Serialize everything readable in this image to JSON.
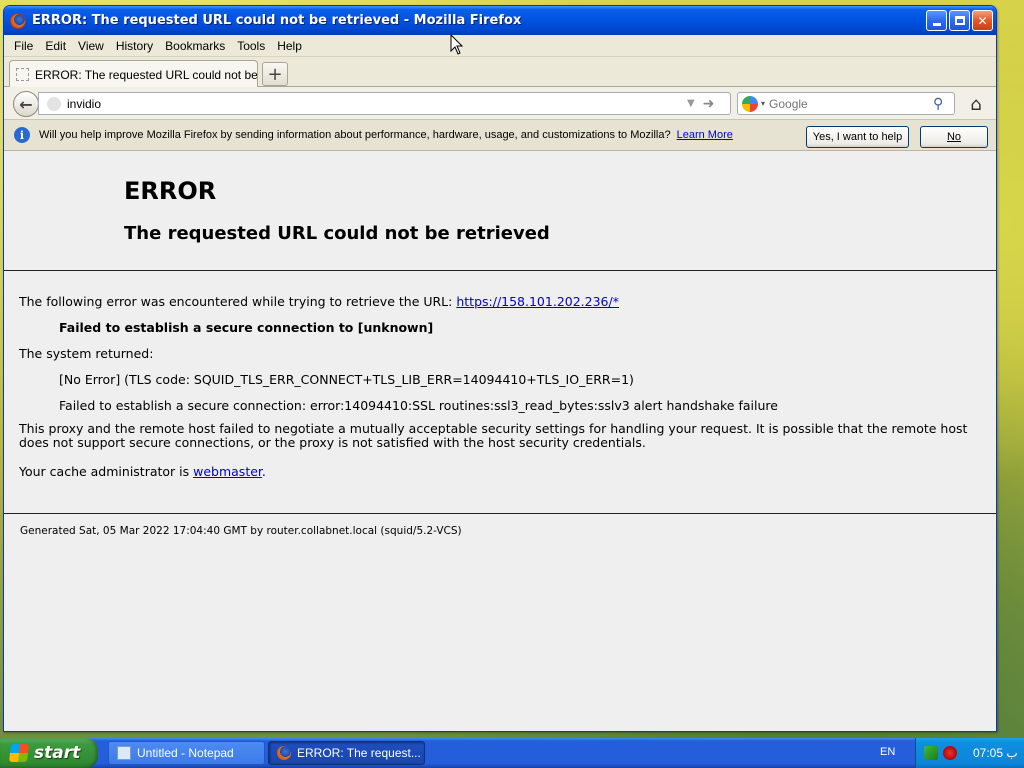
{
  "window": {
    "title": "ERROR: The requested URL could not be retrieved - Mozilla Firefox",
    "minimize_label": "",
    "maximize_label": "",
    "close_label": "✕"
  },
  "menubar": {
    "items": [
      "File",
      "Edit",
      "View",
      "History",
      "Bookmarks",
      "Tools",
      "Help"
    ]
  },
  "tabs": [
    {
      "label": "ERROR: The requested URL could not be ret..."
    }
  ],
  "new_tab_label": "+",
  "navbar": {
    "back_icon": "←",
    "url_value": "invidio",
    "search_placeholder": "Google",
    "home_icon": "⌂"
  },
  "notification": {
    "text": "Will you help improve Mozilla Firefox by sending information about performance, hardware, usage, and customizations to Mozilla?",
    "link": "Learn More",
    "yes_button": "Yes, I want to help",
    "no_button": "No"
  },
  "page": {
    "heading": "ERROR",
    "subheading": "The requested URL could not be retrieved",
    "intro_text": "The following error was encountered while trying to retrieve the URL: ",
    "intro_url": "https://158.101.202.236/*",
    "failed_line": "Failed to establish a secure connection to [unknown]",
    "system_returned": "The system returned:",
    "no_error_line": "[No Error] (TLS code: SQUID_TLS_ERR_CONNECT+TLS_LIB_ERR=14094410+TLS_IO_ERR=1)",
    "ssl_line": "Failed to establish a secure connection: error:14094410:SSL routines:ssl3_read_bytes:sslv3 alert handshake failure",
    "explanation": "This proxy and the remote host failed to negotiate a mutually acceptable security settings for handling your request. It is possible that the remote host does not support secure connections, or the proxy is not satisfied with the host security credentials.",
    "admin_prefix": "Your cache administrator is ",
    "admin_link": "webmaster",
    "admin_suffix": ".",
    "generated": "Generated Sat, 05 Mar 2022 17:04:40 GMT by router.collabnet.local (squid/5.2-VCS)"
  },
  "taskbar": {
    "start_label": "start",
    "items": [
      {
        "label": "Untitled - Notepad",
        "icon": "notepad-icon"
      },
      {
        "label": "ERROR: The request...",
        "icon": "firefox-icon"
      }
    ],
    "language": "EN",
    "clock": "07:05 ب"
  }
}
